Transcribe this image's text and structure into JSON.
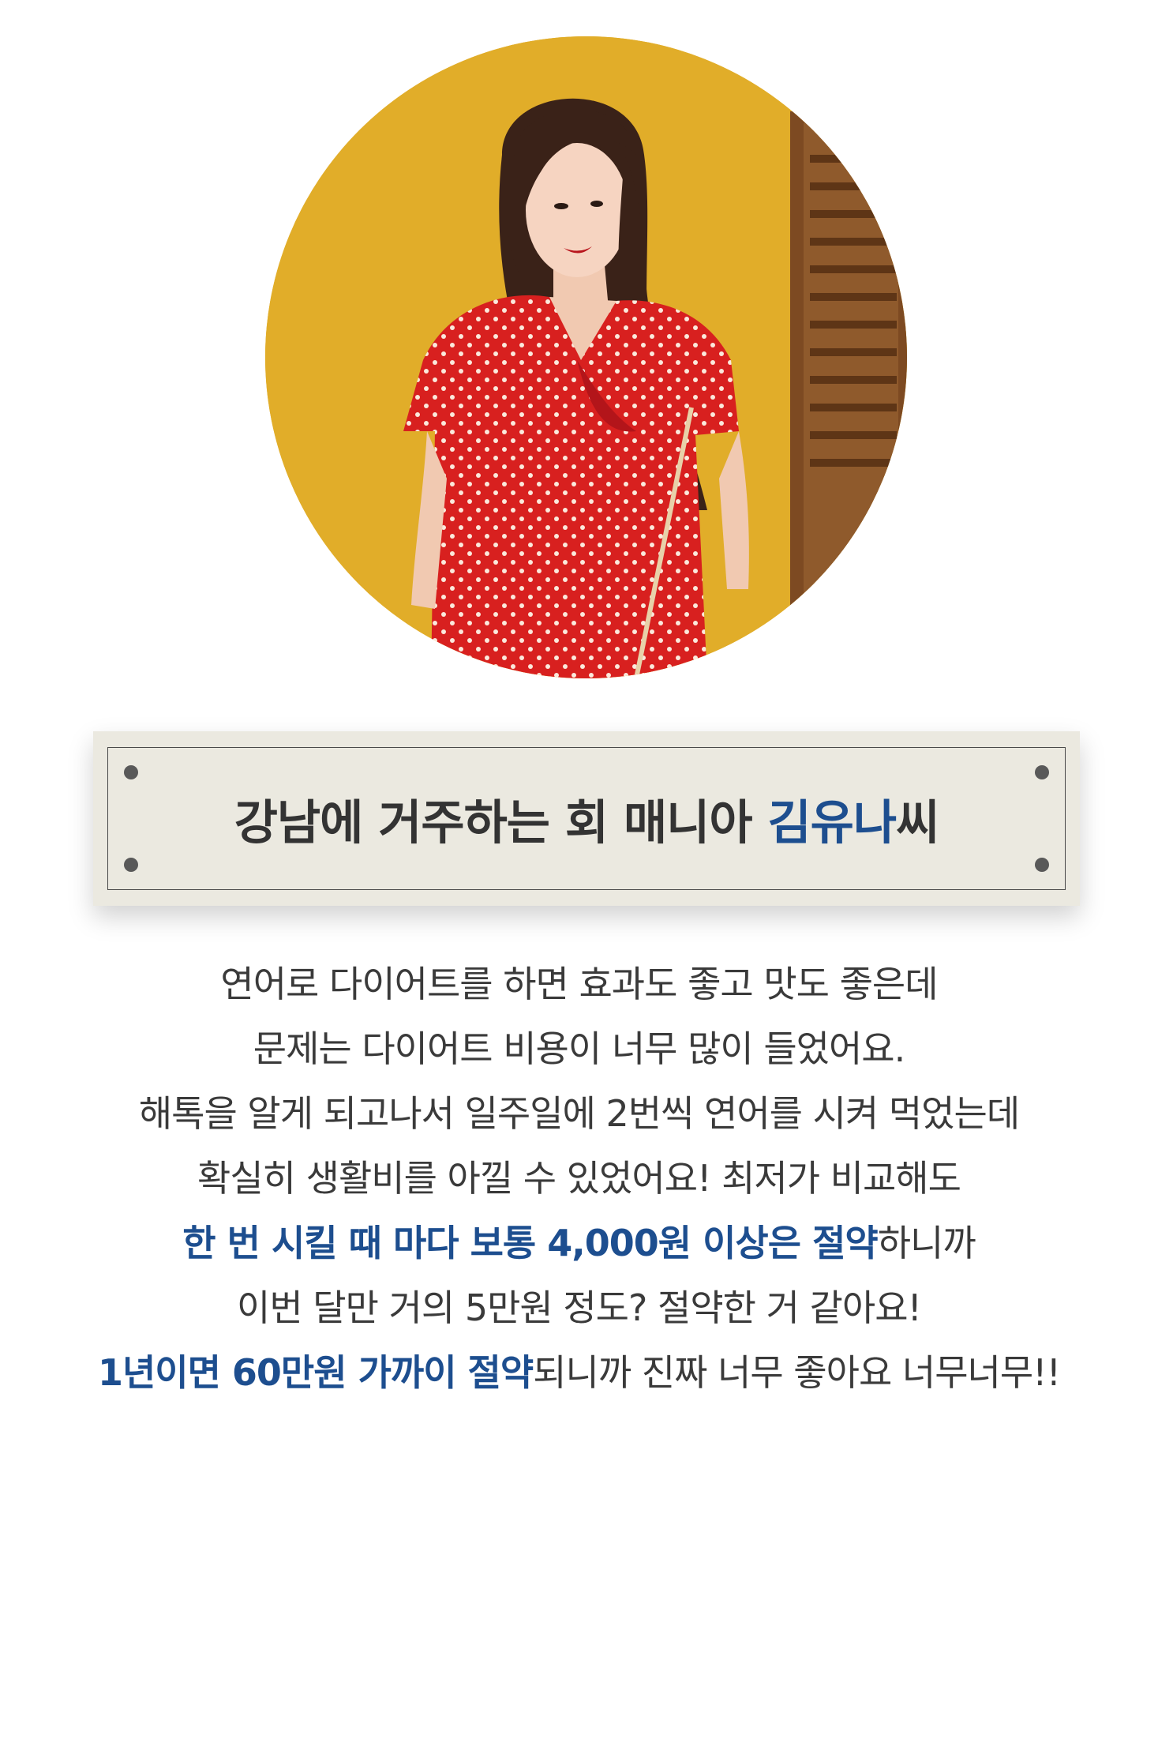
{
  "profile": {
    "photo_alt": "프로필 사진"
  },
  "name_card": {
    "prefix": "강남에 거주하는 회 매니아 ",
    "name": "김유나",
    "suffix": "씨"
  },
  "testimonial": {
    "line1": "연어로 다이어트를 하면 효과도 좋고 맛도 좋은데",
    "line2": "문제는 다이어트 비용이 너무 많이 들었어요.",
    "line3": "해톡을 알게 되고나서 일주일에 2번씩 연어를 시켜 먹었는데",
    "line4": "확실히 생활비를 아낄 수 있었어요! 최저가 비교해도",
    "line5_strong": "한 번 시킬 때 마다 보통 4,000원 이상은 절약",
    "line5_rest": "하니까",
    "line6": "이번 달만 거의 5만원 정도? 절약한 거 같아요!",
    "line7_strong": "1년이면 60만원 가까이 절약",
    "line7_rest": "되니까 진짜 너무 좋아요 너무너무!!"
  },
  "colors": {
    "accent": "#1d4e8f",
    "card_bg": "#ebe9e0",
    "text": "#3a3a3a"
  }
}
